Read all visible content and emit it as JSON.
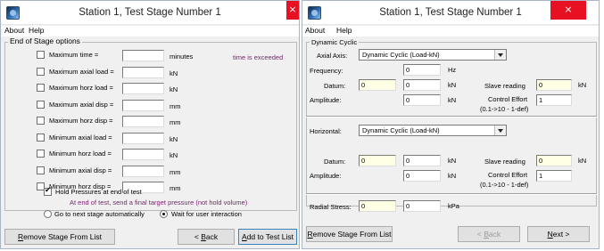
{
  "left_window": {
    "title": "Station 1, Test Stage Number 1",
    "close_glyph": "×",
    "menu": [
      "About",
      "Help"
    ],
    "group_title": "End of Stage options",
    "options": [
      {
        "label": "Maximum time =",
        "unit": "minutes",
        "checked": false
      },
      {
        "label": "Maximum axial load =",
        "unit": "kN",
        "checked": false
      },
      {
        "label": "Maximum horz load =",
        "unit": "kN",
        "checked": false
      },
      {
        "label": "Maximum axial disp =",
        "unit": "mm",
        "checked": false
      },
      {
        "label": "Maximum horz disp =",
        "unit": "mm",
        "checked": false
      },
      {
        "label": "Minimum axial load =",
        "unit": "kN",
        "checked": false
      },
      {
        "label": "Minimum horz load =",
        "unit": "kN",
        "checked": false
      },
      {
        "label": "Minimum axial disp =",
        "unit": "mm",
        "checked": false
      },
      {
        "label": "Minimum horz disp =",
        "unit": "mm",
        "checked": false
      }
    ],
    "exceeded_note": "time is exceeded",
    "hold_pressures": {
      "label": "Hold Pressures at end of test",
      "checked": true
    },
    "hold_note": "At end of test, send a final target pressure (not hold volume)",
    "radio_next": {
      "label": "Go to next stage automatically",
      "selected": false
    },
    "radio_wait": {
      "label": "Wait for user interaction",
      "selected": true
    },
    "buttons": {
      "remove": {
        "prefix": "R",
        "rest": "emove Stage From List"
      },
      "back": {
        "prefix": "< ",
        "u": "B",
        "rest": "ack"
      },
      "add": {
        "prefix": "",
        "u": "A",
        "rest": "dd to Test List"
      }
    }
  },
  "right_window": {
    "title": "Station 1, Test Stage Number 1",
    "close_glyph": "×",
    "menu": [
      "About",
      "Help"
    ],
    "group_title": "Dynamic Cyclic",
    "axial_axis": {
      "label": "Axial Axis:",
      "selected": "Dynamic Cyclic (Load-kN)"
    },
    "frequency": {
      "label": "Frequency:",
      "value": "0",
      "unit": "Hz"
    },
    "axial_datum": {
      "label": "Datum:",
      "current": "0",
      "value": "0",
      "unit": "kN"
    },
    "axial_slave": {
      "label": "Slave reading",
      "value": "0",
      "unit": "kN"
    },
    "axial_amplitude": {
      "label": "Amplitude:",
      "value": "0",
      "unit": "kN"
    },
    "axial_effort": {
      "label": "Control Effort",
      "range": "(0.1->10 - 1-def)",
      "value": "1"
    },
    "horizontal": {
      "label": "Horizontal:",
      "selected": "Dynamic Cyclic (Load-kN)"
    },
    "horz_datum": {
      "label": "Datum:",
      "current": "0",
      "value": "0",
      "unit": "kN"
    },
    "horz_slave": {
      "label": "Slave reading",
      "value": "0",
      "unit": "kN"
    },
    "horz_amplitude": {
      "label": "Amplitude:",
      "value": "0",
      "unit": "kN"
    },
    "horz_effort": {
      "label": "Control Effort",
      "range": "(0.1->10 - 1-def)",
      "value": "1"
    },
    "radial_stress": {
      "label": "Radial Stress:",
      "current": "0",
      "value": "0",
      "unit": "kPa"
    },
    "buttons": {
      "remove": {
        "prefix": "R",
        "rest": "emove Stage From List"
      },
      "back": {
        "prefix": "< ",
        "u": "B",
        "rest": "ack"
      },
      "next": {
        "u": "N",
        "rest": "ext >"
      }
    }
  }
}
